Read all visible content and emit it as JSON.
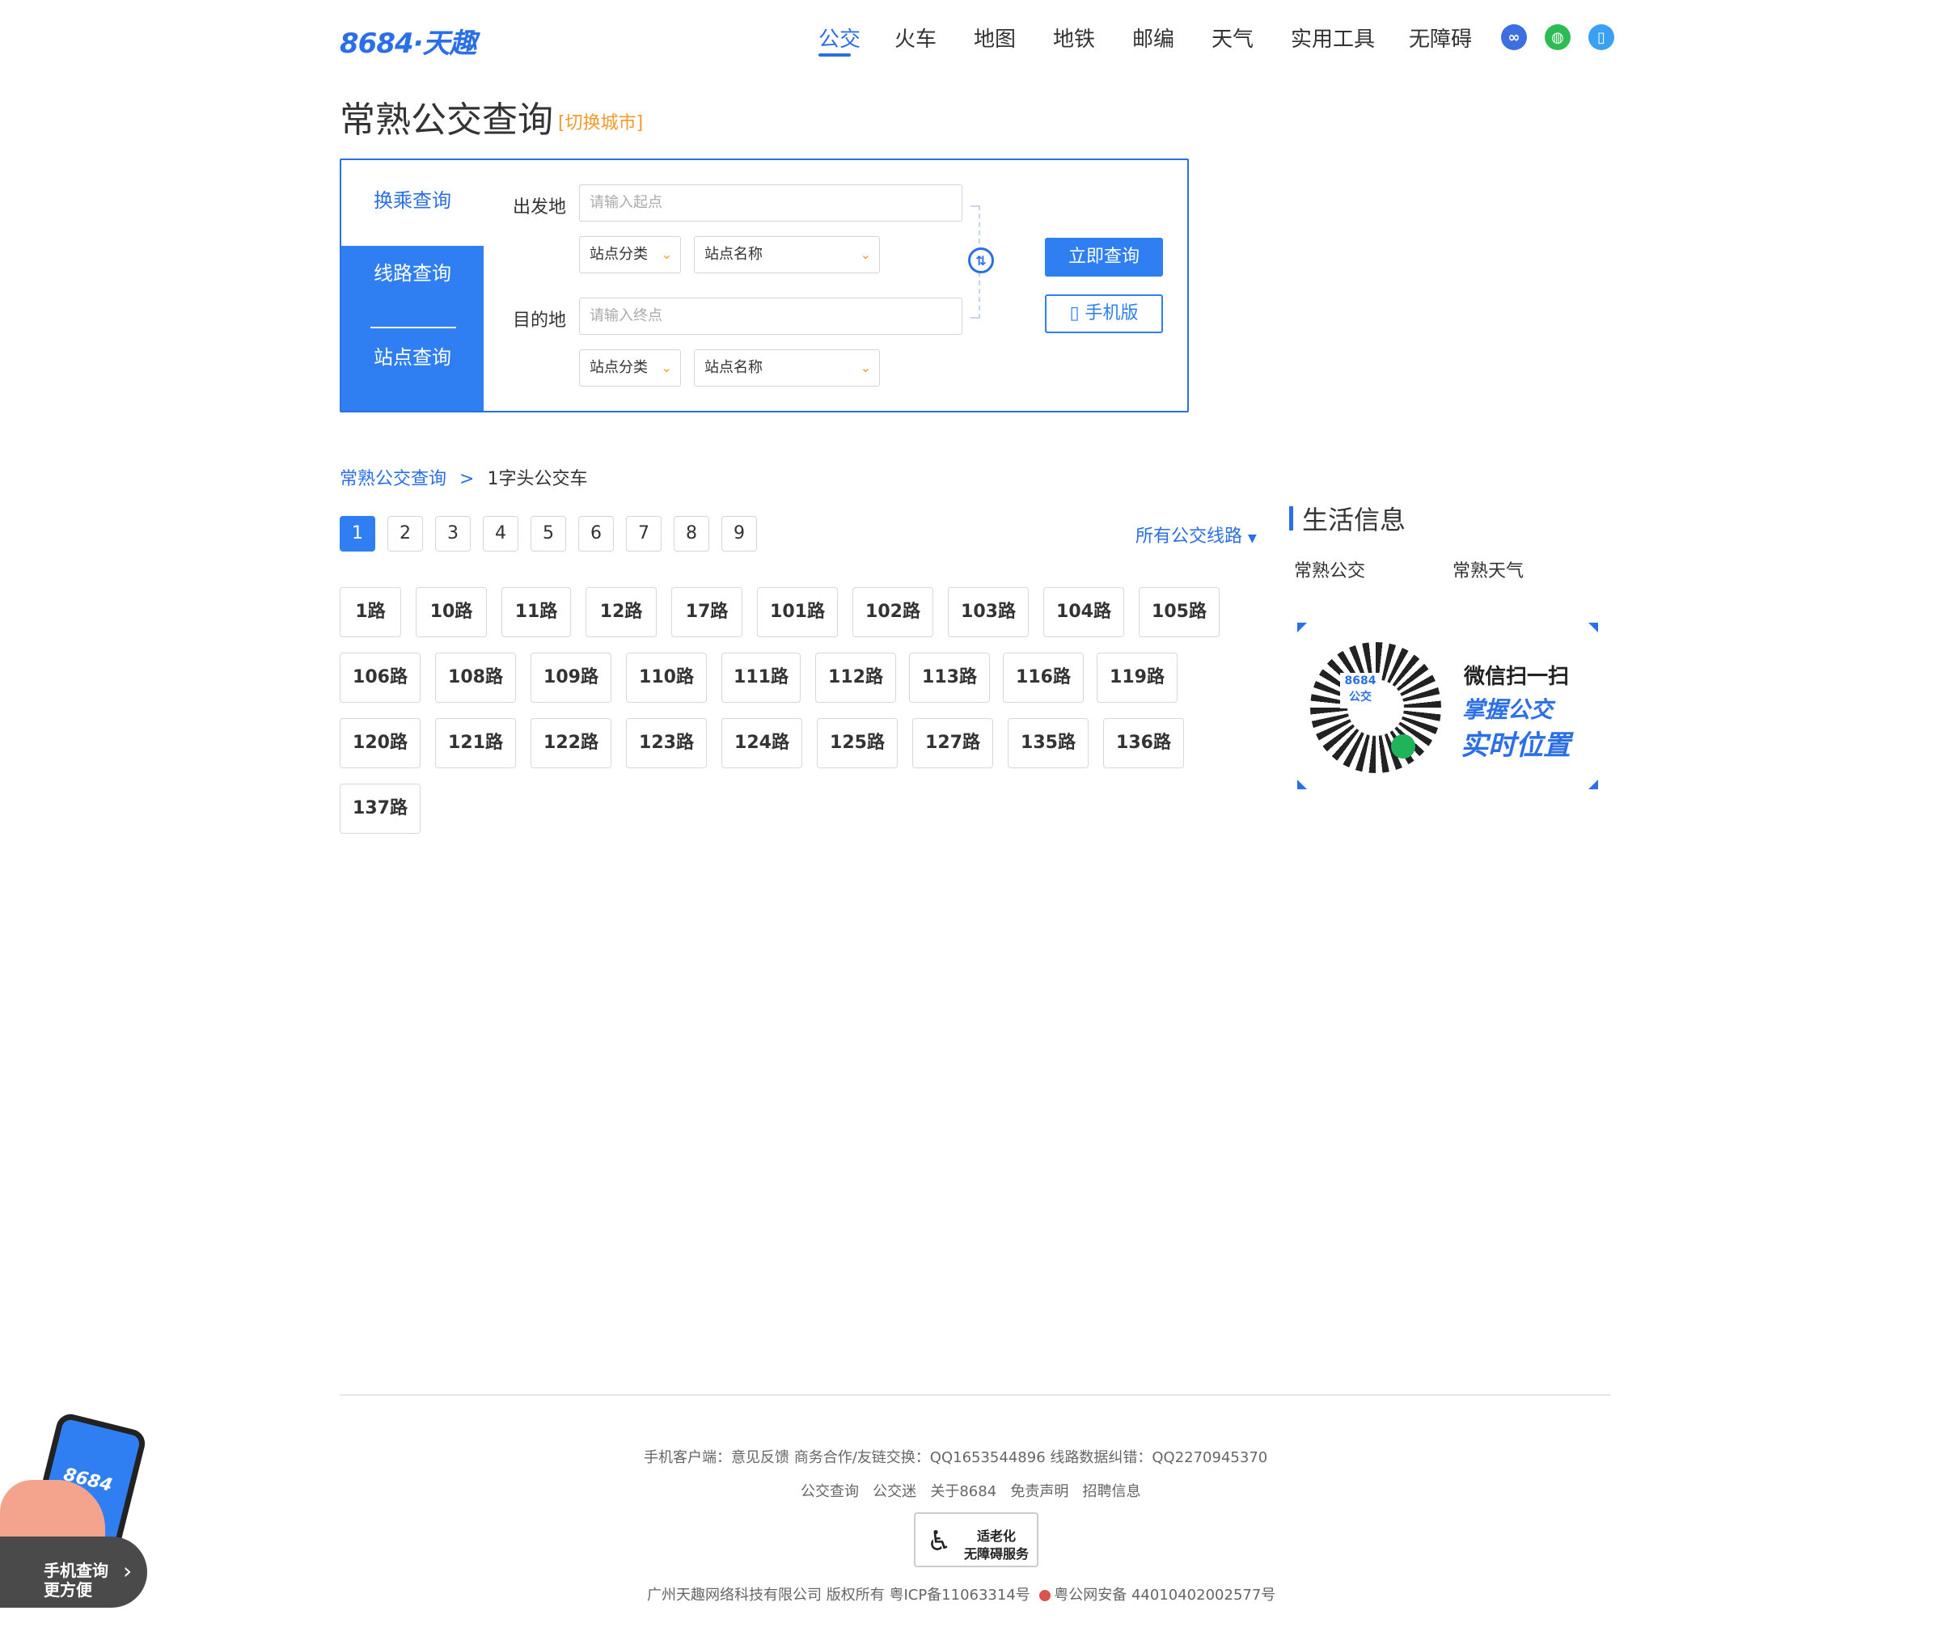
{
  "header": {
    "logo": "8684·天趣",
    "nav": [
      "公交",
      "火车",
      "地图",
      "地铁",
      "邮编",
      "天气",
      "实用工具",
      "无障碍"
    ],
    "active_nav": "公交",
    "icons": [
      "mini-program-icon",
      "wechat-icon",
      "mobile-icon"
    ],
    "accent_color": "#2b6fe8"
  },
  "title": {
    "text": "常熟公交查询",
    "switch_city": "[切换城市]"
  },
  "search": {
    "tabs": {
      "transfer": "换乘查询",
      "line": "线路查询",
      "stop": "站点查询"
    },
    "from_label": "出发地",
    "from_placeholder": "请输入起点",
    "to_label": "目的地",
    "to_placeholder": "请输入终点",
    "stop_category": "站点分类",
    "stop_name": "站点名称",
    "query_button": "立即查询",
    "mobile_button": "手机版"
  },
  "breadcrumb": {
    "link": "常熟公交查询",
    "separator": ">",
    "current": "1字头公交车"
  },
  "pagination": {
    "pages": [
      "1",
      "2",
      "3",
      "4",
      "5",
      "6",
      "7",
      "8",
      "9"
    ],
    "active": "1",
    "all_routes": "所有公交线路"
  },
  "routes": [
    "1路",
    "10路",
    "11路",
    "12路",
    "17路",
    "101路",
    "102路",
    "103路",
    "104路",
    "105路",
    "106路",
    "108路",
    "109路",
    "110路",
    "111路",
    "112路",
    "113路",
    "116路",
    "119路",
    "120路",
    "121路",
    "122路",
    "123路",
    "124路",
    "125路",
    "127路",
    "135路",
    "136路",
    "137路"
  ],
  "sidebar": {
    "title": "生活信息",
    "links": [
      "常熟公交",
      "常熟天气"
    ],
    "qr": {
      "center_text": "8684 公交",
      "line1": "微信扫一扫",
      "line2": "掌握公交",
      "line3": "实时位置"
    }
  },
  "footer": {
    "row1": "手机客户端：意见反馈     商务合作/友链交换：QQ1653544896   线路数据纠错：QQ2270945370",
    "row2": [
      "公交查询",
      "公交迷",
      "关于8684",
      "免责声明",
      "招聘信息"
    ],
    "badge_line1": "适老化",
    "badge_line2": "无障碍服务",
    "row3_company": "广州天趣网络科技有限公司  版权所有  粤ICP备11063314号",
    "row3_police": "粤公网安备 44010402002577号"
  },
  "floating": {
    "logo": "8684",
    "line1": "手机查询",
    "line2": "更方便"
  }
}
